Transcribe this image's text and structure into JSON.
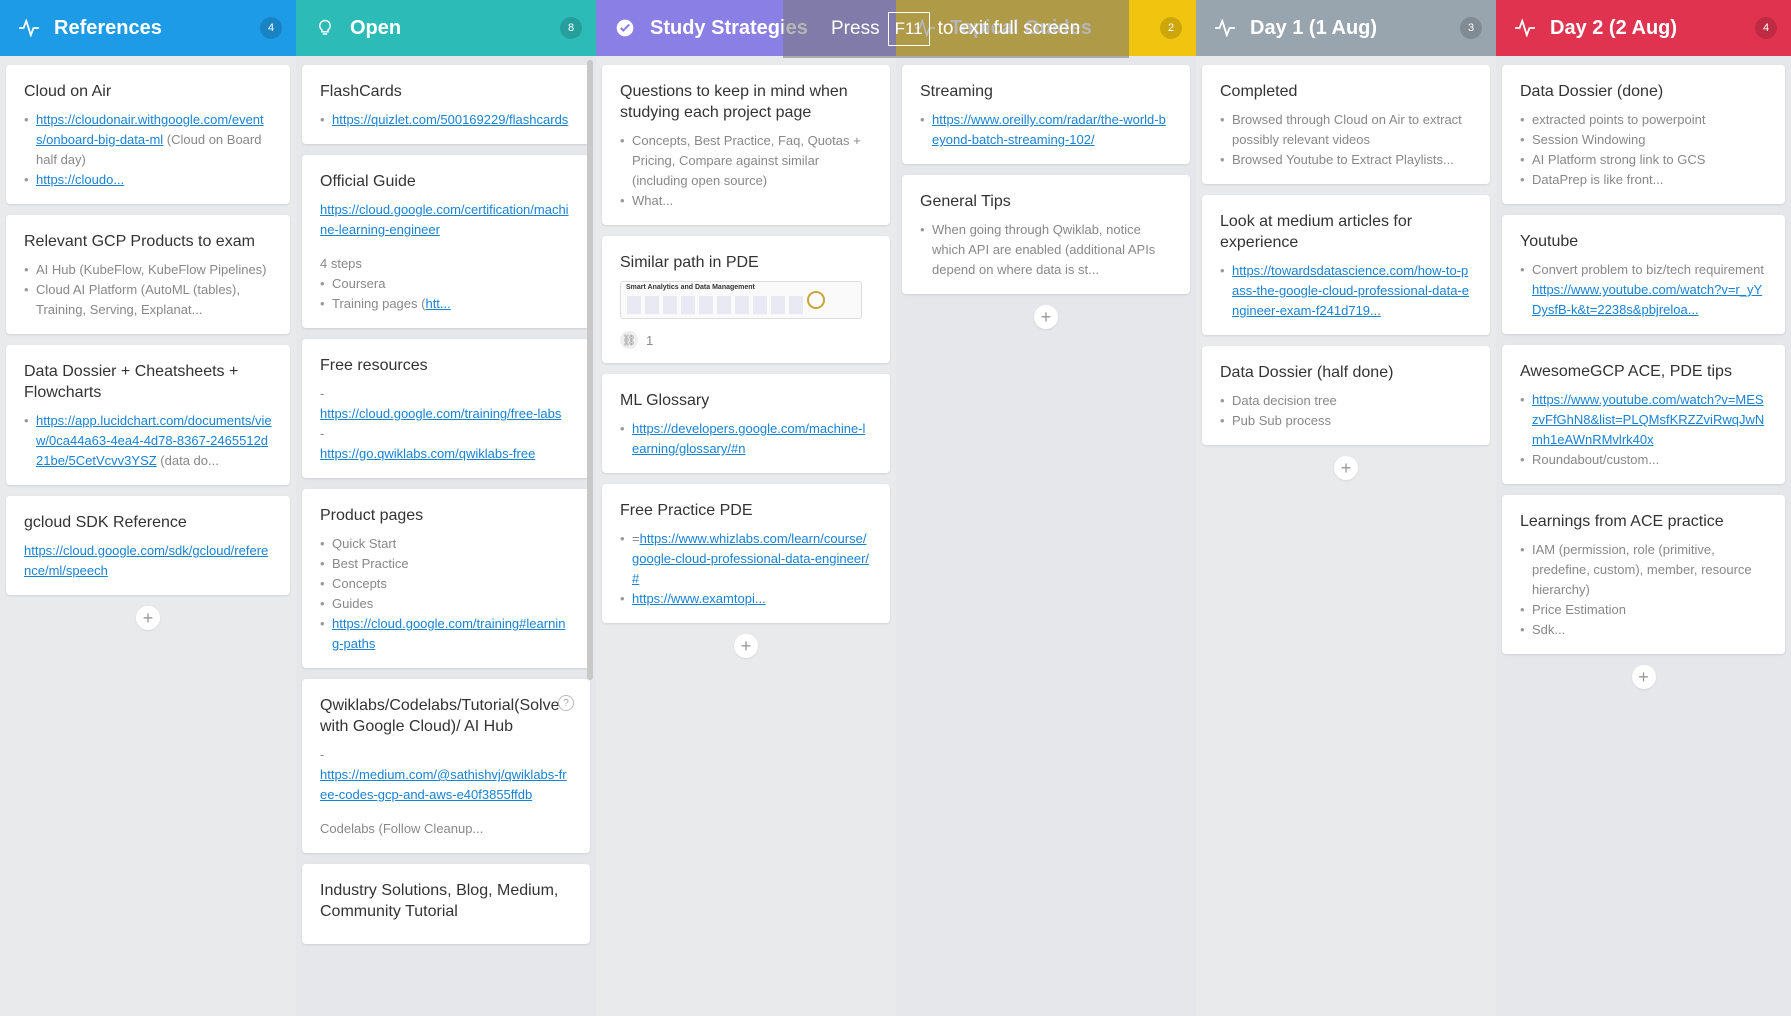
{
  "colors": {
    "references": "#1e9be6",
    "open": "#2dbbb8",
    "study": "#8a7fe4",
    "topical": "#f1c40f",
    "day1": "#98a4ae",
    "day2": "#e0334f"
  },
  "fullscreen_notice": {
    "press": "Press",
    "key": "F11",
    "rest": "to exit full screen"
  },
  "columns": [
    {
      "title": "References",
      "count": "4",
      "icon": "pulse-icon",
      "cards": [
        {
          "title": "Cloud on Air",
          "items": [
            {
              "link": "https://cloudonair.withgoogle.com/events/onboard-big-data-ml",
              "text": " (Cloud on Board half day)"
            },
            {
              "link": "https://cloudo...",
              "text": ""
            }
          ]
        },
        {
          "title": "Relevant GCP Products to exam",
          "items": [
            {
              "text": "AI Hub (KubeFlow, KubeFlow Pipelines)"
            },
            {
              "text": "Cloud AI Platform (AutoML (tables), Training, Serving, Explanat..."
            }
          ]
        },
        {
          "title": "Data Dossier + Cheatsheets + Flowcharts",
          "items": [
            {
              "link": "https://app.lucidchart.com/documents/view/0ca44a63-4ea4-4d78-8367-2465512d21be/5CetVcvv3YSZ",
              "text": " (data do..."
            }
          ]
        },
        {
          "title": "gcloud SDK Reference",
          "plain_link": "https://cloud.google.com/sdk/gcloud/reference/ml/speech"
        }
      ]
    },
    {
      "title": "Open",
      "count": "8",
      "icon": "lightbulb-icon",
      "cards": [
        {
          "title": "FlashCards",
          "items": [
            {
              "link": "https://quizlet.com/500169229/flashcards",
              "text": ""
            }
          ]
        },
        {
          "title": "Official Guide",
          "plain_link": "https://cloud.google.com/certification/machine-learning-engineer",
          "para": "4 steps",
          "items": [
            {
              "text": "Coursera"
            },
            {
              "text": "Training pages (",
              "link": "htt..."
            }
          ]
        },
        {
          "title": "Free resources",
          "dash_lines": [
            {
              "prefix": "-",
              "link": "https://cloud.google.com/training/free-labs"
            },
            {
              "prefix": "-",
              "link": "https://go.qwiklabs.com/qwiklabs-free"
            }
          ]
        },
        {
          "title": "Product pages",
          "items": [
            {
              "text": "Quick Start"
            },
            {
              "text": "Best Practice"
            },
            {
              "text": "Concepts"
            },
            {
              "text": "Guides"
            },
            {
              "link": "https://cloud.google.com/training#learning-paths",
              "text": ""
            }
          ]
        },
        {
          "title": "Qwiklabs/Codelabs/Tutorial(Solve with Google Cloud)/ AI Hub",
          "help": "?",
          "dash_lines": [
            {
              "prefix": "-",
              "link": "https://medium.com/@sathishvj/qwiklabs-free-codes-gcp-and-aws-e40f3855ffdb"
            }
          ],
          "para": "Codelabs (Follow Cleanup..."
        },
        {
          "title": "Industry Solutions, Blog, Medium, Community Tutorial"
        }
      ]
    },
    {
      "title": "Study Strategies",
      "count": "",
      "icon": "check-circle-icon",
      "cards": [
        {
          "title": "Questions to keep in mind when studying each project page",
          "items": [
            {
              "text": "Concepts, Best Practice, Faq, Quotas + Pricing, Compare against similar (including open source)"
            },
            {
              "text": "What..."
            }
          ]
        },
        {
          "title": "Similar path in PDE",
          "thumb": "Smart Analytics and Data Management",
          "attachments": "1"
        },
        {
          "title": "ML Glossary",
          "items": [
            {
              "link": "https://developers.google.com/machine-learning/glossary/#n",
              "text": ""
            }
          ]
        },
        {
          "title": "Free Practice PDE",
          "items": [
            {
              "link": "https://www.whizlabs.com/learn/course/google-cloud-professional-data-engineer/#",
              "text": "="
            },
            {
              "link": "https://www.examtopi...",
              "text": ""
            }
          ]
        }
      ]
    },
    {
      "title": "Topical Guides",
      "count": "2",
      "icon": "pulse-icon",
      "cards": [
        {
          "title": "Streaming",
          "items": [
            {
              "link": "https://www.oreilly.com/radar/the-world-beyond-batch-streaming-102/",
              "text": ""
            }
          ]
        },
        {
          "title": "General Tips",
          "items": [
            {
              "text": "When going through Qwiklab, notice which API are enabled (additional APIs depend on where data is st..."
            }
          ]
        }
      ]
    },
    {
      "title": "Day 1 (1 Aug)",
      "count": "3",
      "icon": "pulse-icon",
      "cards": [
        {
          "title": "Completed",
          "items": [
            {
              "text": "Browsed through Cloud on Air to extract possibly relevant videos"
            },
            {
              "text": "Browsed Youtube to Extract Playlists..."
            }
          ]
        },
        {
          "title": "Look at medium articles for experience",
          "items": [
            {
              "link": "https://towardsdatascience.com/how-to-pass-the-google-cloud-professional-data-engineer-exam-f241d719...",
              "text": ""
            }
          ]
        },
        {
          "title": "Data Dossier (half done)",
          "items": [
            {
              "text": "Data decision tree"
            },
            {
              "text": "Pub Sub process"
            }
          ]
        }
      ]
    },
    {
      "title": "Day 2 (2 Aug)",
      "count": "4",
      "icon": "pulse-icon",
      "cards": [
        {
          "title": "Data Dossier (done)",
          "items": [
            {
              "text": "extracted points to powerpoint"
            },
            {
              "text": "Session Windowing"
            },
            {
              "text": "AI Platform strong link to GCS"
            },
            {
              "text": "DataPrep is like front..."
            }
          ]
        },
        {
          "title": "Youtube",
          "items": [
            {
              "text": "Convert problem to biz/tech requirement ",
              "link": "https://www.youtube.com/watch?v=r_yYDysfB-k&t=2238s&pbjreloa..."
            }
          ]
        },
        {
          "title": "AwesomeGCP ACE, PDE tips",
          "items": [
            {
              "link": "https://www.youtube.com/watch?v=MESzvFfGhN8&list=PLQMsfKRZZviRwqJwNmh1eAWnRMvlrk40x",
              "text": ""
            },
            {
              "text": "Roundabout/custom..."
            }
          ]
        },
        {
          "title": "Learnings from ACE practice",
          "items": [
            {
              "text": "IAM (permission, role (primitive, predefine, custom), member, resource hierarchy)"
            },
            {
              "text": "Price Estimation"
            },
            {
              "text": "Sdk..."
            }
          ]
        }
      ]
    }
  ],
  "add_label": "+"
}
